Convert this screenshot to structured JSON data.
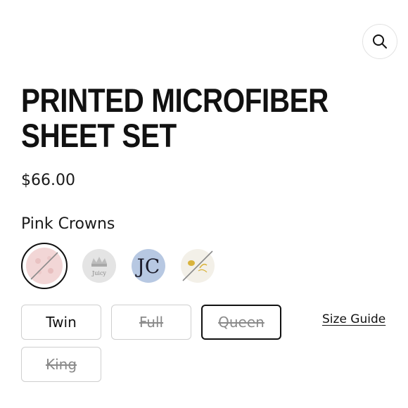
{
  "header": {
    "search_icon": "search-icon"
  },
  "product": {
    "title_line1": "PRINTED MICROFIBER",
    "title_line2": "SHEET SET",
    "price": "$66.00",
    "color_name": "Pink Crowns",
    "swatches": [
      {
        "name": "Pink Crowns",
        "color": "#f2d6d6",
        "selected": true,
        "available": false
      },
      {
        "name": "Grey Crown Juicy",
        "color": "#e6e6e6",
        "selected": false,
        "available": true,
        "label": "Juicy"
      },
      {
        "name": "Blue JC Monogram",
        "color": "#b7c8e2",
        "selected": false,
        "available": true,
        "label": "JC"
      },
      {
        "name": "White Gold Bee",
        "color": "#f4f1ea",
        "selected": false,
        "available": false
      }
    ],
    "sizes": [
      {
        "label": "Twin",
        "available": true,
        "selected": false
      },
      {
        "label": "Full",
        "available": false,
        "selected": false
      },
      {
        "label": "Queen",
        "available": false,
        "selected": true
      },
      {
        "label": "King",
        "available": false,
        "selected": false
      }
    ],
    "size_guide_label": "Size Guide"
  },
  "colors": {
    "text": "#111111",
    "muted": "#8a8a8a",
    "border": "#cfcfcf"
  }
}
